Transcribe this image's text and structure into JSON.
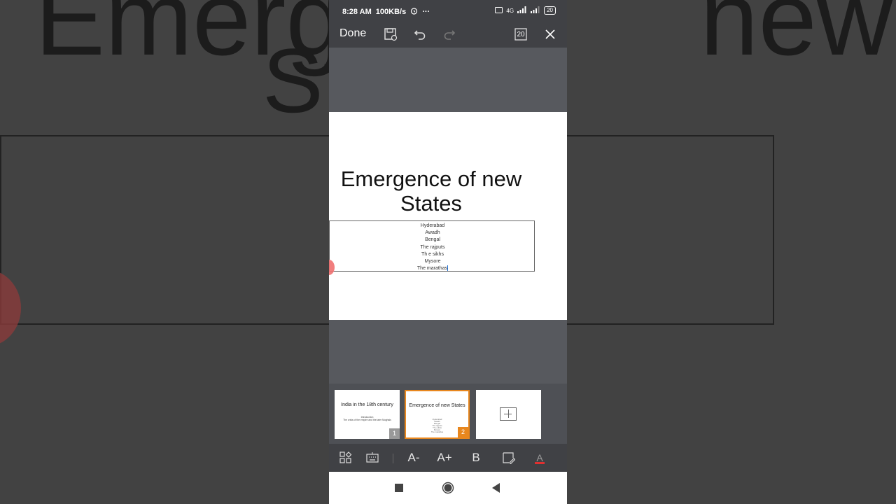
{
  "background": {
    "title_fragment_1": "Emerge",
    "title_fragment_2": "St",
    "title_fragment_3": "new"
  },
  "status_bar": {
    "time": "8:28 AM",
    "speed": "100KB/s",
    "more": "···",
    "network": "4G",
    "battery": "20"
  },
  "toolbar": {
    "done_label": "Done",
    "slide_count": "20"
  },
  "slide": {
    "title": "Emergence of new States",
    "items": [
      "Hyderabad",
      "Awadh",
      "Bengal",
      "The rajputs",
      "Th e sikhs",
      "Mysore",
      "The marathas"
    ]
  },
  "thumbnails": [
    {
      "title": "India in the 18th century",
      "subtitle_1": "Introduction",
      "subtitle_2": "The crisis of the empire and the later Mughals",
      "number": "1"
    },
    {
      "title": "Emergence of new States",
      "mini_lines": [
        "Hyderabad",
        "Awadh",
        "Bengal",
        "The rajputs",
        "Th e sikhs",
        "Mysore",
        "The marathas"
      ],
      "number": "2"
    }
  ],
  "format_bar": {
    "decrease_font": "A-",
    "increase_font": "A+",
    "bold": "B",
    "font_color": "A",
    "font_color_value": "#e03030"
  },
  "colors": {
    "accent": "#e8871e",
    "toolbar": "#404145",
    "canvas": "#57595e"
  }
}
